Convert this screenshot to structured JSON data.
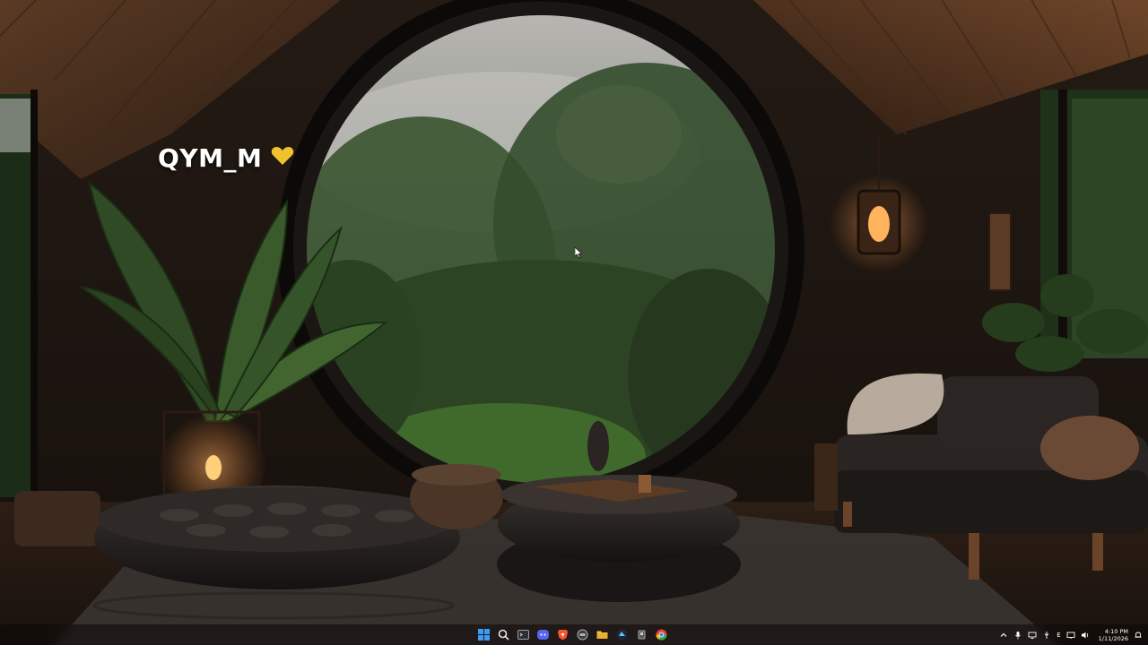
{
  "desktop": {
    "label": "QYM_M",
    "heart": "💛",
    "heart_color": "#f2c12e"
  },
  "taskbar": {
    "apps": [
      {
        "name": "start-icon",
        "color": "#3b9cf5"
      },
      {
        "name": "search-icon",
        "color": "#e6e6e6"
      },
      {
        "name": "terminal-icon",
        "color": "#9aa0a6"
      },
      {
        "name": "discord-icon",
        "color": "#5865f2"
      },
      {
        "name": "brave-icon",
        "color": "#fb542b"
      },
      {
        "name": "app-icon",
        "color": "#b0b0b0"
      },
      {
        "name": "file-explorer-icon",
        "color": "#f5c542"
      },
      {
        "name": "steam-icon",
        "color": "#66c0f4"
      },
      {
        "name": "app-icon-2",
        "color": "#a6a6a6"
      },
      {
        "name": "chrome-icon",
        "color": "#ea4335"
      }
    ],
    "tray": {
      "language": "E",
      "time": "4:10 PM",
      "date": "1/11/2026"
    }
  }
}
